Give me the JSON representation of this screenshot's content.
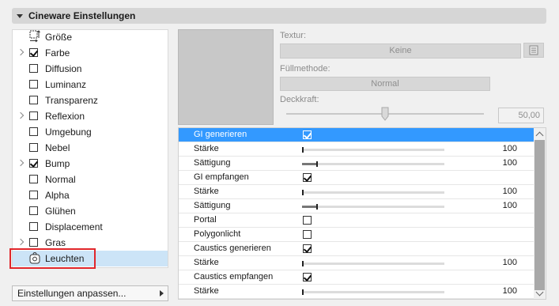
{
  "panel": {
    "title": "Cineware Einstellungen"
  },
  "channels": [
    {
      "label": "Größe",
      "checkbox": false,
      "checked": false,
      "expandable": false,
      "icon": "size-icon"
    },
    {
      "label": "Farbe",
      "checkbox": true,
      "checked": true,
      "expandable": true
    },
    {
      "label": "Diffusion",
      "checkbox": true,
      "checked": false,
      "expandable": false
    },
    {
      "label": "Luminanz",
      "checkbox": true,
      "checked": false,
      "expandable": false
    },
    {
      "label": "Transparenz",
      "checkbox": true,
      "checked": false,
      "expandable": false
    },
    {
      "label": "Reflexion",
      "checkbox": true,
      "checked": false,
      "expandable": true
    },
    {
      "label": "Umgebung",
      "checkbox": true,
      "checked": false,
      "expandable": false
    },
    {
      "label": "Nebel",
      "checkbox": true,
      "checked": false,
      "expandable": false
    },
    {
      "label": "Bump",
      "checkbox": true,
      "checked": true,
      "expandable": true
    },
    {
      "label": "Normal",
      "checkbox": true,
      "checked": false,
      "expandable": false
    },
    {
      "label": "Alpha",
      "checkbox": true,
      "checked": false,
      "expandable": false
    },
    {
      "label": "Glühen",
      "checkbox": true,
      "checked": false,
      "expandable": false
    },
    {
      "label": "Displacement",
      "checkbox": true,
      "checked": false,
      "expandable": false
    },
    {
      "label": "Gras",
      "checkbox": true,
      "checked": false,
      "expandable": true
    },
    {
      "label": "Leuchten",
      "checkbox": false,
      "checked": false,
      "expandable": false,
      "icon": "light-icon",
      "selected": true
    }
  ],
  "settings_button": {
    "label": "Einstellungen anpassen..."
  },
  "texture": {
    "label": "Textur:",
    "value": "Keine",
    "fill_label": "Füllmethode:",
    "fill_value": "Normal",
    "opacity_label": "Deckkraft:",
    "opacity_value": "50,00",
    "opacity_level": 0.5
  },
  "gi_rows": [
    {
      "name": "GI generieren",
      "type": "checkbox",
      "checked": true,
      "selected": true
    },
    {
      "name": "Stärke",
      "type": "slider",
      "level": 0.0,
      "value": "100"
    },
    {
      "name": "Sättigung",
      "type": "slider",
      "level": 0.1,
      "value": "100"
    },
    {
      "name": "GI empfangen",
      "type": "checkbox",
      "checked": true
    },
    {
      "name": "Stärke",
      "type": "slider",
      "level": 0.0,
      "value": "100"
    },
    {
      "name": "Sättigung",
      "type": "slider",
      "level": 0.1,
      "value": "100"
    },
    {
      "name": "Portal",
      "type": "checkbox",
      "checked": false
    },
    {
      "name": "Polygonlicht",
      "type": "checkbox",
      "checked": false
    },
    {
      "name": "Caustics generieren",
      "type": "checkbox",
      "checked": true
    },
    {
      "name": "Stärke",
      "type": "slider",
      "level": 0.0,
      "value": "100"
    },
    {
      "name": "Caustics empfangen",
      "type": "checkbox",
      "checked": true
    },
    {
      "name": "Stärke",
      "type": "slider",
      "level": 0.0,
      "value": "100"
    }
  ],
  "colors": {
    "selection": "#3399ff",
    "highlight_box": "#e0262b",
    "list_selected": "#cce4f7"
  }
}
